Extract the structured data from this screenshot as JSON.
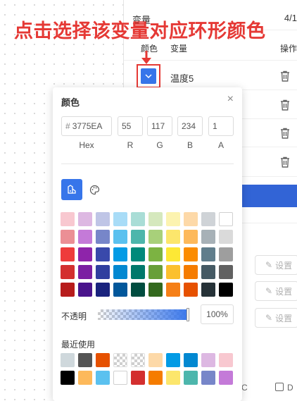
{
  "annotation": {
    "text": "点击选择该变量对应环形颜色"
  },
  "panel": {
    "header": "变量",
    "header_right": "4/1",
    "columns": {
      "color": "颜色",
      "variable": "变量",
      "action": "操作"
    },
    "rows": [
      {
        "name": "温度5",
        "color": "#3775EA"
      }
    ],
    "set_label": "设置",
    "bottom_c": "C",
    "bottom_d": "D"
  },
  "picker": {
    "title": "颜色",
    "hex_prefix": "#",
    "hex": "3775EA",
    "r": "55",
    "g": "117",
    "b": "234",
    "a": "1",
    "labels": {
      "hex": "Hex",
      "r": "R",
      "g": "G",
      "b": "B",
      "a": "A"
    },
    "opacity_label": "不透明",
    "opacity_value": "100%",
    "opacity_level": 1.0,
    "recent_label": "最近使用",
    "palette": [
      [
        "#F8C8D0",
        "#DDB8E2",
        "#BFC5E6",
        "#A8DCF7",
        "#A9DDD6",
        "#D5E8BD",
        "#FCF3B0",
        "#FDD9A8",
        "#CFD3D7",
        "#FFFFFF"
      ],
      [
        "#EB8F95",
        "#C47AD8",
        "#7786C9",
        "#5BC1EF",
        "#4DB6AC",
        "#A8D07A",
        "#FCE66C",
        "#FDB95B",
        "#A7B1B7",
        "#DADADA"
      ],
      [
        "#EE3B3B",
        "#8E24AA",
        "#3949AB",
        "#039BE5",
        "#00897B",
        "#7CB342",
        "#FDE835",
        "#FB8C00",
        "#607D8B",
        "#9E9E9E"
      ],
      [
        "#D32F2F",
        "#7B1FA2",
        "#303F9F",
        "#0288D1",
        "#00796B",
        "#689F38",
        "#FBC02D",
        "#F57C00",
        "#455A64",
        "#616161"
      ],
      [
        "#B71C1C",
        "#4A148C",
        "#1A237E",
        "#01579B",
        "#004D40",
        "#33691E",
        "#F57F17",
        "#E65100",
        "#263238",
        "#000000"
      ]
    ],
    "recent": [
      [
        "#CFD8DC",
        "#555555",
        "#E65100",
        "transparent",
        "transparent",
        "#FDD9A8",
        "#039BE5",
        "#0288D1",
        "#DDB8E2",
        "#F8C8D0"
      ],
      [
        "#000000",
        "#FDB95B",
        "#5BC1EF",
        "#FFFFFF",
        "#D32F2F",
        "#F57C00",
        "#FCE66C",
        "#4DB6AC",
        "#7786C9",
        "#C47AD8"
      ]
    ]
  }
}
